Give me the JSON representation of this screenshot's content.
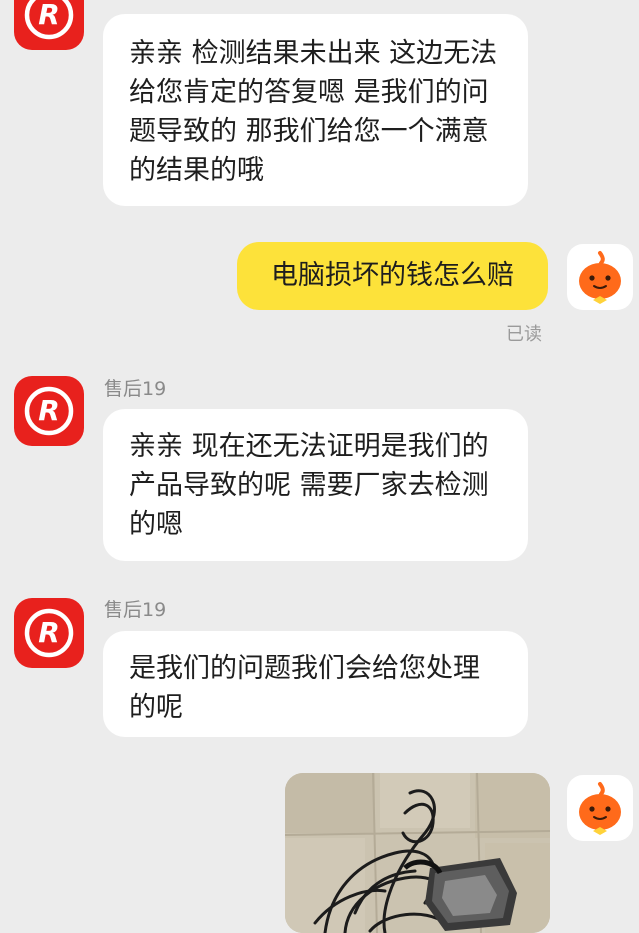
{
  "messages": [
    {
      "sender": "",
      "text": "亲亲 检测结果未出来 这边无法给您肯定的答复嗯 是我们的问题导致的 那我们给您一个满意的结果的哦"
    },
    {
      "text": "电脑损坏的钱怎么赔",
      "status": "已读"
    },
    {
      "sender": "售后19",
      "text": "亲亲 现在还无法证明是我们的产品导致的呢 需要厂家去检测的嗯"
    },
    {
      "sender": "售后19",
      "text": "是我们的问题我们会给您处理的呢"
    }
  ],
  "icons": {
    "merchant_avatar": "brand-r-logo-icon",
    "user_avatar": "orange-mascot-icon",
    "photo": "burnt-charger-photo"
  },
  "colors": {
    "background": "#ececec",
    "own_bubble": "#fde23a",
    "other_bubble": "#ffffff",
    "brand_red": "#e8211d",
    "mascot_orange": "#ff6a1a"
  }
}
